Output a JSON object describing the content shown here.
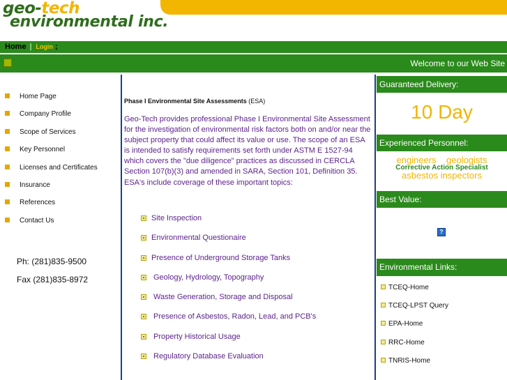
{
  "logo": {
    "line1_a": "geo-",
    "line1_b": "tech",
    "line2": "environmental inc."
  },
  "nav": {
    "home": "Home",
    "separator": "|",
    "login": "Login",
    "semicolon": ";"
  },
  "welcome": "Welcome to our Web Site",
  "left_menu": [
    "Home Page",
    "Company Profile",
    "Scope of Services",
    "Key Personnel",
    "Licenses and Certificates",
    "Insurance",
    "References",
    "Contact Us"
  ],
  "contact": {
    "phone": "Ph: (281)835-9500",
    "fax": "Fax (281)835-8972"
  },
  "main": {
    "heading": "Phase I Environmental Site Assessments",
    "heading_abbr": "(ESA)",
    "intro": "Geo-Tech provides professional Phase I Environmental Site Assessment for the investigation of environmental risk factors both on and/or near the subject property that could affect its value or use.  The scope of an ESA is intended to satisfy requirements set forth under ASTM E 1527-94 which covers the \"due diligence\" practices as discussed in CERCLA Section 107(b)(3) and amended in SARA, Section 101, Definition 35.  ESA's include coverage of these important topics:",
    "topics": [
      "Site Inspection",
      "Environmental Questionaire",
      "Presence of Underground Storage Tanks",
      "Geology, Hydrology, Topography",
      "Waste Generation, Storage and Disposal",
      "Presence of Asbestos, Radon, Lead, and PCB's",
      "Property Historical Usage",
      "Regulatory Database Evaluation"
    ]
  },
  "right": {
    "guaranteed": "Guaranteed Delivery:",
    "ten_day": "10 Day",
    "experienced": "Experienced Personnel:",
    "personnel_line1": "engineers    geologists",
    "personnel_line2": "Corrective Action Specialist",
    "personnel_line3": "asbestos inspectors",
    "best_value": "Best Value:",
    "question_mark": "?",
    "env_links_head": "Environmental Links:",
    "env_links": [
      "TCEQ-Home",
      "TCEQ-LPST Query",
      "EPA-Home",
      "RRC-Home",
      "TNRIS-Home"
    ]
  }
}
